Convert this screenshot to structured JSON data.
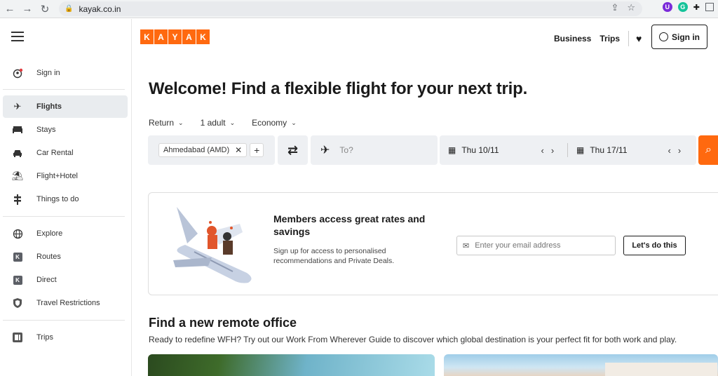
{
  "browser": {
    "url": "kayak.co.in",
    "icons": [
      "back-arrow-icon",
      "forward-arrow-icon",
      "reload-icon",
      "lock-icon",
      "share-icon",
      "star-icon",
      "extension-icon",
      "puzzle-icon",
      "sidepanel-icon"
    ]
  },
  "sidebar": {
    "sign_in": "Sign in",
    "items": [
      {
        "label": "Flights",
        "icon": "airplane-icon",
        "active": true
      },
      {
        "label": "Stays",
        "icon": "bed-icon"
      },
      {
        "label": "Car Rental",
        "icon": "car-icon"
      },
      {
        "label": "Flight+Hotel",
        "icon": "beach-umbrella-icon"
      },
      {
        "label": "Things to do",
        "icon": "signpost-icon"
      }
    ],
    "items2": [
      {
        "label": "Explore",
        "icon": "globe-icon"
      },
      {
        "label": "Routes",
        "icon": "kayak-k-icon"
      },
      {
        "label": "Direct",
        "icon": "kayak-k-icon"
      },
      {
        "label": "Travel Restrictions",
        "icon": "shield-icon"
      }
    ],
    "trips": "Trips"
  },
  "header": {
    "logo_letters": [
      "K",
      "A",
      "Y",
      "A",
      "K"
    ],
    "business": "Business",
    "trips": "Trips",
    "sign_in": "Sign in"
  },
  "hero": {
    "title": "Welcome! Find a flexible flight for your next trip.",
    "trip_type": "Return",
    "travellers": "1 adult",
    "cabin": "Economy",
    "origin_chip": "Ahmedabad (AMD)",
    "to_placeholder": "To?",
    "depart_date": "Thu 10/11",
    "return_date": "Thu 17/11"
  },
  "members": {
    "title": "Members access great rates and savings",
    "desc": "Sign up for access to personalised recommendations and Private Deals.",
    "email_placeholder": "Enter your email address",
    "cta": "Let's do this"
  },
  "remote": {
    "title": "Find a new remote office",
    "desc": "Ready to redefine WFH? Try out our Work From Wherever Guide to discover which global destination is your perfect fit for both work and play."
  },
  "colors": {
    "brand": "#ff690f",
    "active_bg": "#e9ecef",
    "search_bg": "#eef0f3"
  }
}
